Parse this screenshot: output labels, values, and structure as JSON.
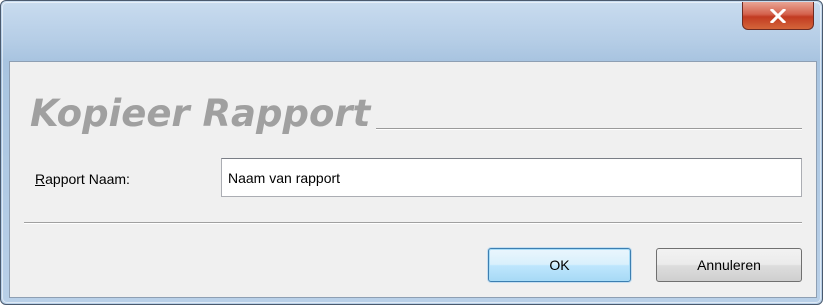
{
  "window": {
    "close_icon": "close-x-icon",
    "accent_close": "#c8402a"
  },
  "dialog": {
    "heading": "Kopieer Rapport",
    "field": {
      "label_mnemonic": "R",
      "label_rest": "apport Naam:",
      "value": "Naam van rapport"
    },
    "buttons": {
      "ok": "OK",
      "cancel": "Annuleren"
    }
  }
}
